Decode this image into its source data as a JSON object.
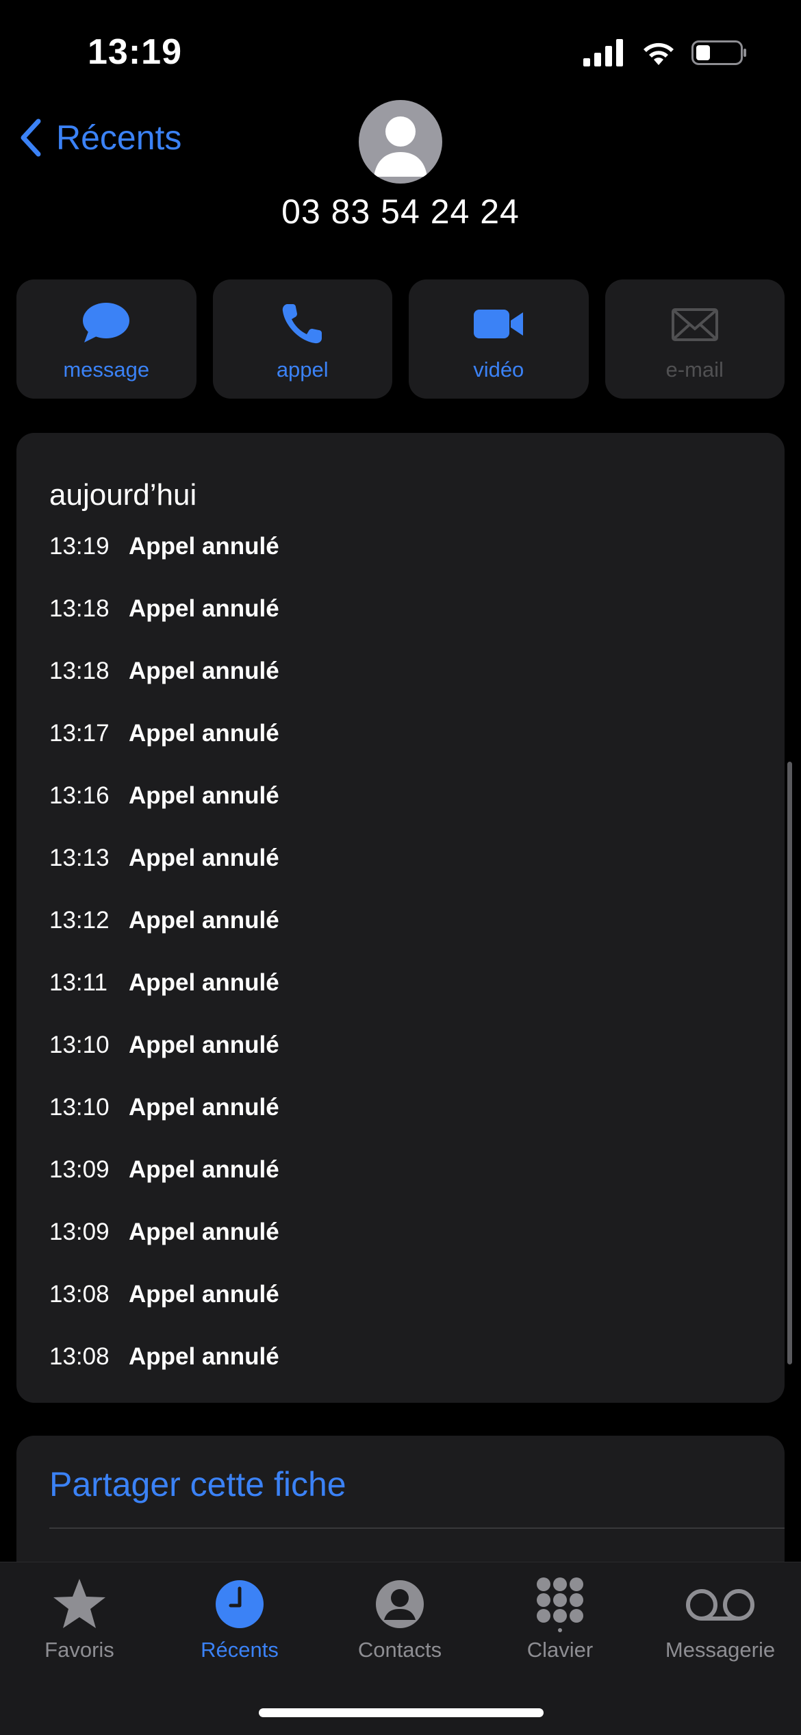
{
  "status_bar": {
    "time": "13:19"
  },
  "nav": {
    "back_label": "Récents"
  },
  "contact": {
    "number": "03 83 54 24 24"
  },
  "actions": [
    {
      "label": "message",
      "icon": "message-bubble-icon",
      "enabled": true
    },
    {
      "label": "appel",
      "icon": "phone-icon",
      "enabled": true
    },
    {
      "label": "vidéo",
      "icon": "video-camera-icon",
      "enabled": true
    },
    {
      "label": "e-mail",
      "icon": "envelope-icon",
      "enabled": false
    }
  ],
  "history": {
    "title": "aujourd’hui",
    "calls": [
      {
        "time": "13:19",
        "status": "Appel annulé"
      },
      {
        "time": "13:18",
        "status": "Appel annulé"
      },
      {
        "time": "13:18",
        "status": "Appel annulé"
      },
      {
        "time": "13:17",
        "status": "Appel annulé"
      },
      {
        "time": "13:16",
        "status": "Appel annulé"
      },
      {
        "time": "13:13",
        "status": "Appel annulé"
      },
      {
        "time": "13:12",
        "status": "Appel annulé"
      },
      {
        "time": "13:11",
        "status": "Appel annulé"
      },
      {
        "time": "13:10",
        "status": "Appel annulé"
      },
      {
        "time": "13:10",
        "status": "Appel annulé"
      },
      {
        "time": "13:09",
        "status": "Appel annulé"
      },
      {
        "time": "13:09",
        "status": "Appel annulé"
      },
      {
        "time": "13:08",
        "status": "Appel annulé"
      },
      {
        "time": "13:08",
        "status": "Appel annulé"
      }
    ]
  },
  "share": {
    "label": "Partager cette fiche"
  },
  "tabs": [
    {
      "label": "Favoris",
      "icon": "star-icon",
      "active": false
    },
    {
      "label": "Récents",
      "icon": "clock-icon",
      "active": true
    },
    {
      "label": "Contacts",
      "icon": "person-circle-icon",
      "active": false
    },
    {
      "label": "Clavier",
      "icon": "keypad-icon",
      "active": false
    },
    {
      "label": "Messagerie",
      "icon": "voicemail-icon",
      "active": false
    }
  ],
  "colors": {
    "accent": "#3b82f6",
    "card": "#1c1c1e",
    "muted": "#8e8e93"
  }
}
